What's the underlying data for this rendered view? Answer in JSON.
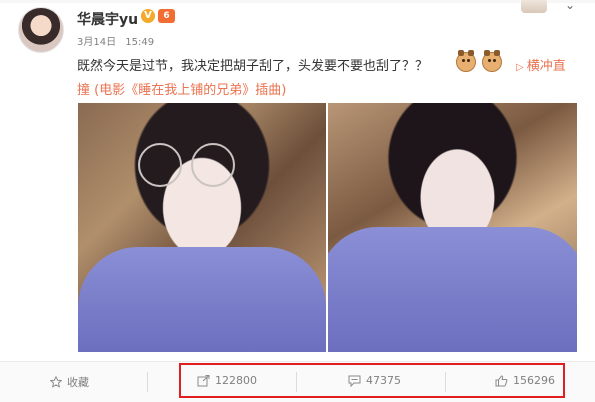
{
  "post": {
    "username": "华晨宇yu",
    "verified_icon": "verified-badge-icon",
    "vip_icon": "vip-badge-icon",
    "date": "3月14日",
    "time": "15:49",
    "text_line1": "既然今天是过节，我决定把胡子刮了，头发要不要也刮了？？",
    "text_line2": "撞 (电影《睡在我上铺的兄弟》插曲)",
    "music_label": "横冲直",
    "music_icon": "play-triangle-icon",
    "emoji_count": 2,
    "photos": [
      "photo-1",
      "photo-2"
    ]
  },
  "actions": {
    "favorite_label": "收藏",
    "repost_count": "122800",
    "comment_count": "47375",
    "like_count": "156296"
  },
  "colors": {
    "accent_link": "#eb7350",
    "highlight_box": "#e02020",
    "meta_text": "#808080"
  }
}
